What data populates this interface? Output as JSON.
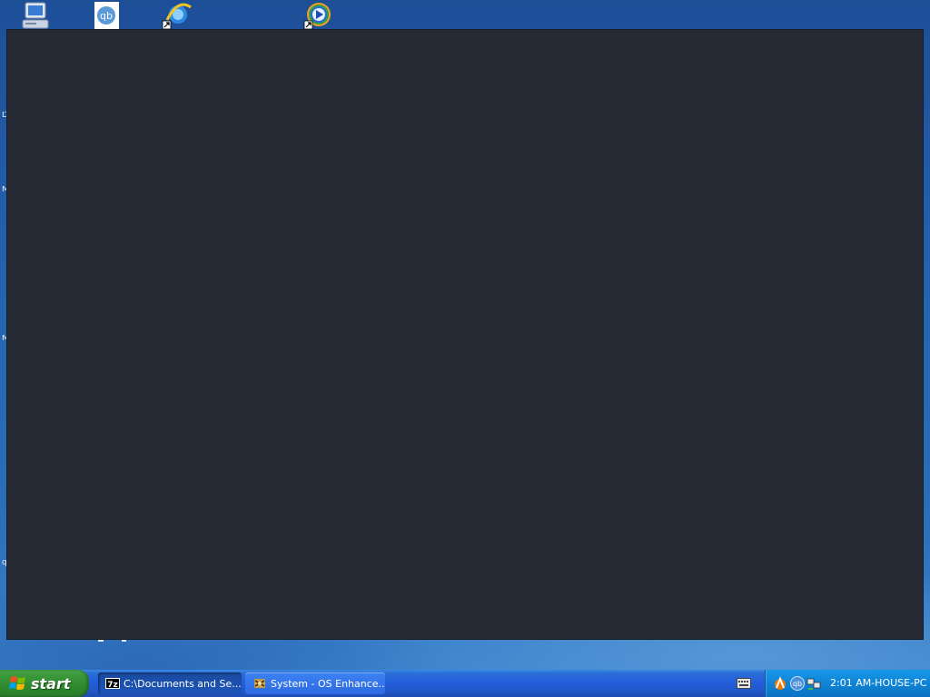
{
  "desktop": {
    "icons": [
      {
        "name": "my-computer-icon"
      },
      {
        "name": "qbittorrent-icon"
      },
      {
        "name": "internet-explorer-icon"
      },
      {
        "name": "windows-media-player-icon"
      }
    ],
    "edge_glyphs": [
      "D",
      "M",
      "M",
      "q"
    ]
  },
  "taskbar": {
    "start_label": "start",
    "tasks": [
      {
        "label": "C:\\Documents and Se...",
        "icon": "7zip-icon",
        "active": true
      },
      {
        "label": "System - OS Enhance...",
        "icon": "system-tool-icon",
        "active": false
      }
    ],
    "tray": {
      "icons": [
        "avast-icon",
        "qbittorrent-tray-icon",
        "network-icon"
      ],
      "clock": "2:01 AM-HOUSE-PC"
    }
  },
  "colors": {
    "window_bg": "#252a34",
    "taskbar_blue": "#245edb",
    "start_green": "#3c9a3c",
    "tray_blue": "#0f84d6"
  }
}
